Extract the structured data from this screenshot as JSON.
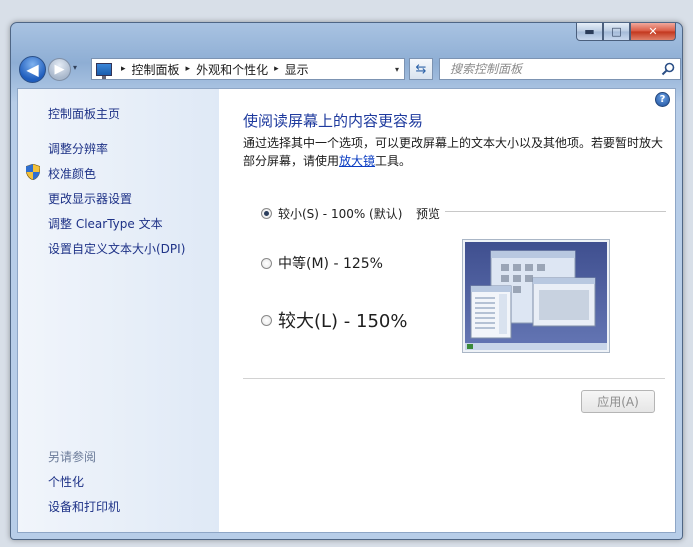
{
  "window": {
    "caption_buttons": {
      "minimize": "▬",
      "maximize": "□",
      "close": "✕"
    }
  },
  "nav": {
    "back_glyph": "◀",
    "forward_glyph": "▶",
    "history_glyph": "▾",
    "breadcrumbs": [
      "控制面板",
      "外观和个性化",
      "显示"
    ],
    "crumb_separator": "▸",
    "address_dropdown": "▾",
    "refresh_glyph": "⇆",
    "search_placeholder": "搜索控制面板"
  },
  "sidebar": {
    "home_link": "控制面板主页",
    "tasks": [
      "调整分辨率",
      "校准颜色",
      "更改显示器设置",
      "调整 ClearType 文本",
      "设置自定义文本大小(DPI)"
    ],
    "see_also_title": "另请参阅",
    "see_also": [
      "个性化",
      "设备和打印机"
    ]
  },
  "main": {
    "help_glyph": "?",
    "title": "使阅读屏幕上的内容更容易",
    "description_part1": "通过选择其中一个选项，可以更改屏幕上的文本大小以及其他项。若要暂时放大部分屏幕，请使用",
    "description_link": "放大镜",
    "description_part2": "工具。",
    "options": [
      {
        "label": "较小(S) - 100% (默认)",
        "checked": true
      },
      {
        "label": "中等(M) - 125%",
        "checked": false
      },
      {
        "label": "较大(L) - 150%",
        "checked": false
      }
    ],
    "preview_label": "预览",
    "apply_button": "应用(A)"
  },
  "colors": {
    "link": "#1e3287",
    "title": "#1e3a9e",
    "preview_desktop": "#4f5f9e"
  }
}
